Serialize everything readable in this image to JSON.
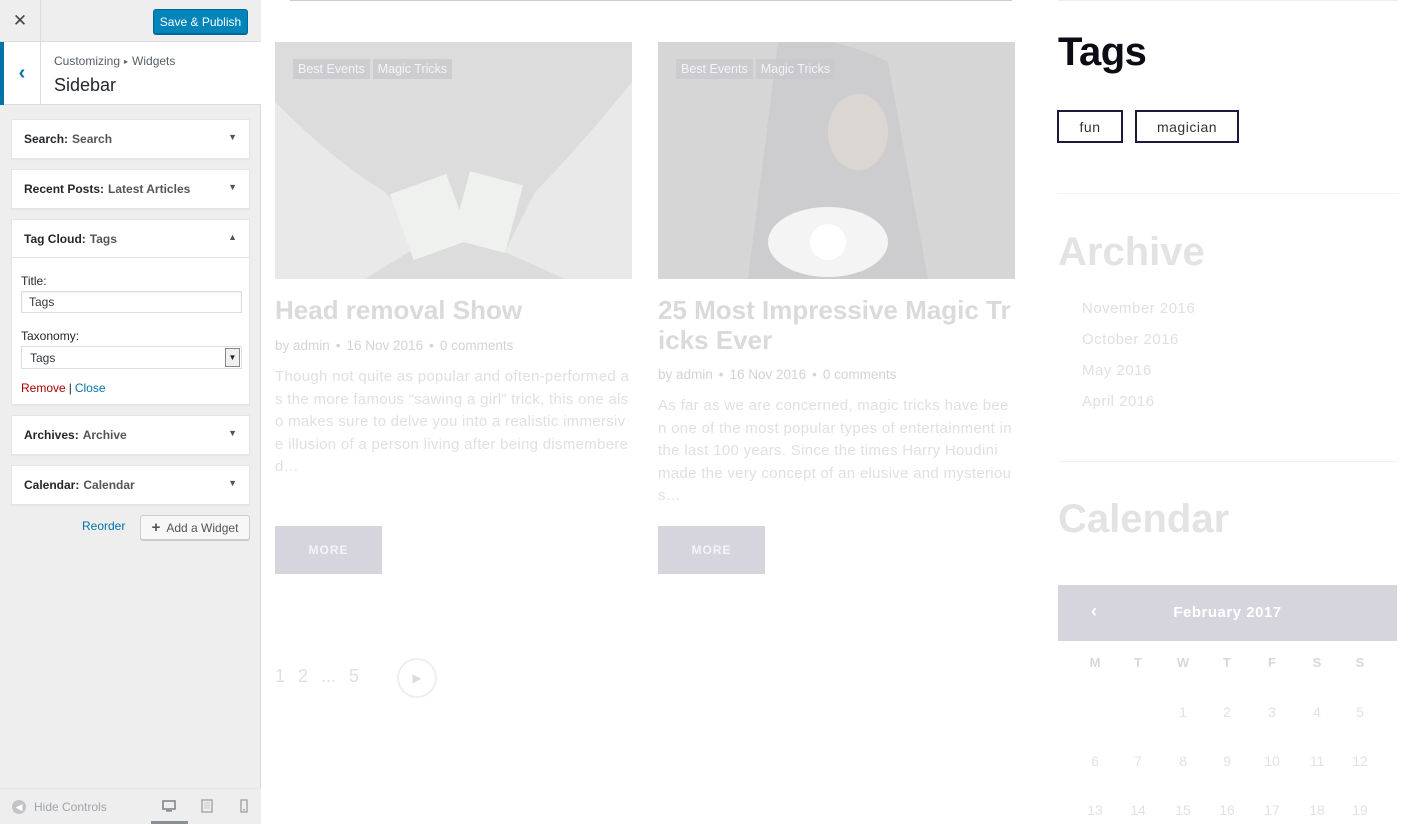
{
  "customizer": {
    "close_glyph": "✕",
    "publish_label": "Save & Publish",
    "back_glyph": "‹",
    "breadcrumb": [
      "Customizing",
      "Widgets"
    ],
    "breadcrumb_sep": "▸",
    "section_title": "Sidebar",
    "widgets": [
      {
        "type": "Search:",
        "title": "Search",
        "expanded": false
      },
      {
        "type": "Recent Posts:",
        "title": "Latest Articles",
        "expanded": false
      },
      {
        "type": "Tag Cloud:",
        "title": "Tags",
        "expanded": true
      },
      {
        "type": "Archives:",
        "title": "Archive",
        "expanded": false
      },
      {
        "type": "Calendar:",
        "title": "Calendar",
        "expanded": false
      }
    ],
    "arrow_down": "▼",
    "arrow_up": "▲",
    "tagcloud_form": {
      "title_label": "Title:",
      "title_value": "Tags",
      "taxonomy_label": "Taxonomy:",
      "taxonomy_value": "Tags",
      "remove_label": "Remove",
      "separator": "|",
      "close_label": "Close"
    },
    "reorder_label": "Reorder",
    "add_widget_label": "Add a Widget",
    "add_widget_plus": "+",
    "hide_controls_label": "Hide Controls"
  },
  "preview": {
    "posts": [
      {
        "categories": [
          "Best Events",
          "Magic Tricks"
        ],
        "title": "Head removal Show",
        "author": "by admin",
        "date": "16 Nov 2016",
        "comments": "0 comments",
        "excerpt": "Though not quite as popular and often-performed as the more famous “sawing a girl” trick, this one also makes sure to delve you into a realistic immersive illusion of a person living after being dismembered…",
        "more_label": "MORE"
      },
      {
        "categories": [
          "Best Events",
          "Magic Tricks"
        ],
        "title": "25 Most Impressive Magic Tricks Ever",
        "author": "by admin",
        "date": "16 Nov 2016",
        "comments": "0 comments",
        "excerpt": "As far as we are concerned, magic tricks have been one of the most popular types of entertainment in the last 100 years. Since the times Harry Houdini made the very concept of an elusive and mysterious…",
        "more_label": "MORE"
      }
    ],
    "meta_dot": "•",
    "pagination": [
      "1",
      "2",
      "...",
      "5"
    ],
    "next_glyph": "▶",
    "tags_heading": "Tags",
    "tags": [
      "fun",
      "magician"
    ],
    "archive_heading": "Archive",
    "archive_items": [
      "November 2016",
      "October 2016",
      "May 2016",
      "April 2016"
    ],
    "calendar_heading": "Calendar",
    "calendar_prev": "‹",
    "calendar_month": "February 2017",
    "calendar_days": [
      "M",
      "T",
      "W",
      "T",
      "F",
      "S",
      "S"
    ],
    "calendar_rows": [
      [
        "",
        "",
        "1",
        "2",
        "3",
        "4",
        "5"
      ],
      [
        "6",
        "7",
        "8",
        "9",
        "10",
        "11",
        "12"
      ],
      [
        "13",
        "14",
        "15",
        "16",
        "17",
        "18",
        "19"
      ]
    ]
  }
}
